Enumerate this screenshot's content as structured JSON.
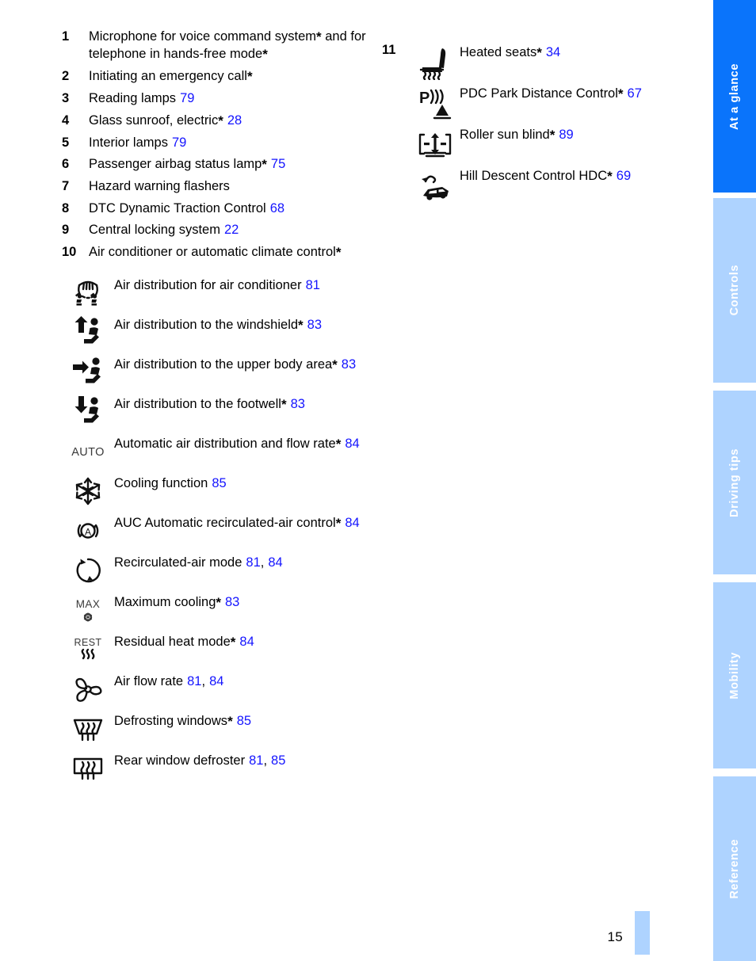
{
  "page": {
    "folio": "15",
    "accent_active": "#0a74fb",
    "accent_inactive": "#aed3ff",
    "link_color": "#1414ff"
  },
  "rail": {
    "tabs": [
      {
        "label": "At a glance",
        "active": true
      },
      {
        "label": "Controls",
        "active": false
      },
      {
        "label": "Driving tips",
        "active": false
      },
      {
        "label": "Mobility",
        "active": false
      },
      {
        "label": "Reference",
        "active": false
      }
    ]
  },
  "left_column": {
    "numbered_items": [
      {
        "num": "1",
        "text": "Microphone for voice command system* and for telephone in hands-free mode*",
        "page": ""
      },
      {
        "num": "2",
        "text": "Initiating an emergency call*",
        "page": ""
      },
      {
        "num": "3",
        "text": "Reading lamps",
        "page": "79"
      },
      {
        "num": "4",
        "text": "Glass sunroof, electric*",
        "page": "28"
      },
      {
        "num": "5",
        "text": "Interior lamps",
        "page": "79"
      },
      {
        "num": "6",
        "text": "Passenger airbag status lamp*",
        "page": "75"
      },
      {
        "num": "7",
        "text": "Hazard warning flashers",
        "page": ""
      },
      {
        "num": "8",
        "text": "DTC Dynamic Traction Control",
        "page": "68"
      },
      {
        "num": "9",
        "text": "Central locking system",
        "page": "22"
      },
      {
        "num": "10",
        "text": "Air conditioner or automatic climate control*",
        "page": ""
      }
    ],
    "icon_items": [
      {
        "icon": "air-distribution-conditioner-icon",
        "text": "Air distribution for air conditioner",
        "pages": [
          "81"
        ]
      },
      {
        "icon": "air-distribution-windshield-icon",
        "text": "Air distribution to the windshield*",
        "pages": [
          "83"
        ]
      },
      {
        "icon": "air-distribution-upper-body-icon",
        "text": "Air distribution to the upper body area*",
        "pages": [
          "83"
        ]
      },
      {
        "icon": "air-distribution-footwell-icon",
        "text": "Air distribution to the footwell*",
        "pages": [
          "83"
        ]
      },
      {
        "icon": "auto-climate-icon",
        "text": "Automatic air distribution and flow rate*",
        "pages": [
          "84"
        ]
      },
      {
        "icon": "snowflake-cooling-icon",
        "text": "Cooling function",
        "pages": [
          "85"
        ]
      },
      {
        "icon": "auc-recirculated-air-icon",
        "text": "AUC Automatic recirculated-air control*",
        "pages": [
          "84"
        ]
      },
      {
        "icon": "recirculated-air-mode-icon",
        "text": "Recirculated-air mode",
        "pages": [
          "81",
          "84"
        ]
      },
      {
        "icon": "max-cooling-icon",
        "text": "Maximum cooling*",
        "pages": [
          "83"
        ]
      },
      {
        "icon": "residual-heat-icon",
        "text": "Residual heat mode*",
        "pages": [
          "84"
        ]
      },
      {
        "icon": "fan-air-flow-rate-icon",
        "text": "Air flow rate",
        "pages": [
          "81",
          "84"
        ]
      },
      {
        "icon": "defrost-windshield-icon",
        "text": "Defrosting windows*",
        "pages": [
          "85"
        ]
      },
      {
        "icon": "rear-window-defroster-icon",
        "text": "Rear window defroster",
        "pages": [
          "81",
          "85"
        ]
      }
    ]
  },
  "right_column": {
    "number": "11",
    "icon_items": [
      {
        "icon": "heated-seat-icon",
        "text": "Heated seats*",
        "pages": [
          "34"
        ]
      },
      {
        "icon": "pdc-park-distance-icon",
        "text": "PDC Park Distance Control*",
        "pages": [
          "67"
        ]
      },
      {
        "icon": "roller-sun-blind-icon",
        "text": "Roller sun blind*",
        "pages": [
          "89"
        ]
      },
      {
        "icon": "hill-descent-control-icon",
        "text": "Hill Descent Control HDC*",
        "pages": [
          "69"
        ]
      }
    ]
  }
}
